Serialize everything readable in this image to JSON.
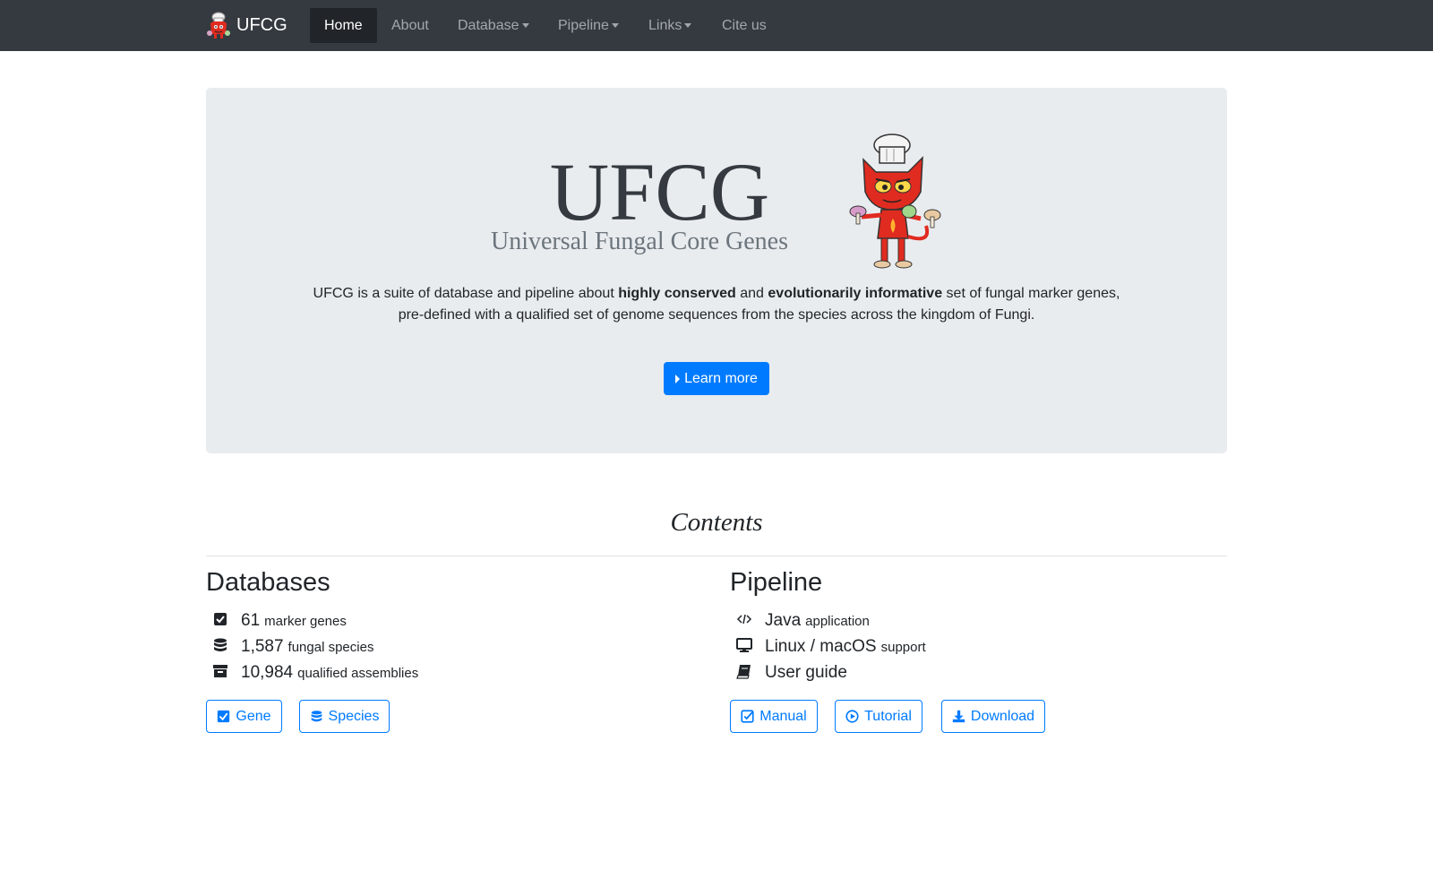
{
  "nav": {
    "brand": "UFCG",
    "items": [
      {
        "label": "Home",
        "active": true
      },
      {
        "label": "About"
      },
      {
        "label": "Database",
        "dropdown": true
      },
      {
        "label": "Pipeline",
        "dropdown": true
      },
      {
        "label": "Links",
        "dropdown": true
      },
      {
        "label": "Cite us"
      }
    ]
  },
  "hero": {
    "title": "UFCG",
    "subtitle": "Universal Fungal Core Genes",
    "desc_part1": "UFCG is a suite of database and pipeline about ",
    "desc_bold1": "highly conserved",
    "desc_part2": " and ",
    "desc_bold2": "evolutionarily informative",
    "desc_part3": " set of fungal marker genes,",
    "desc_line2": "pre-defined with a qualified set of genome sequences from the species across the kingdom of Fungi.",
    "learn_more": "Learn more"
  },
  "contents": {
    "title": "Contents",
    "databases": {
      "title": "Databases",
      "stats": [
        {
          "icon": "check-square-icon",
          "value": "61",
          "label": "marker genes"
        },
        {
          "icon": "database-icon",
          "value": "1,587",
          "label": "fungal species"
        },
        {
          "icon": "archive-icon",
          "value": "10,984",
          "label": "qualified assemblies"
        }
      ],
      "buttons": [
        {
          "icon": "check-square-icon",
          "label": "Gene"
        },
        {
          "icon": "database-icon",
          "label": "Species"
        }
      ]
    },
    "pipeline": {
      "title": "Pipeline",
      "stats": [
        {
          "icon": "code-icon",
          "value": "Java",
          "label": "application"
        },
        {
          "icon": "desktop-icon",
          "value": "Linux / macOS",
          "label": "support"
        },
        {
          "icon": "book-icon",
          "value": "User guide",
          "label": ""
        }
      ],
      "buttons": [
        {
          "icon": "check-square-outline-icon",
          "label": "Manual"
        },
        {
          "icon": "play-circle-icon",
          "label": "Tutorial"
        },
        {
          "icon": "download-icon",
          "label": "Download"
        }
      ]
    }
  },
  "colors": {
    "navbar": "#343a40",
    "primary": "#007bff",
    "jumbotron": "#e9ecef"
  }
}
